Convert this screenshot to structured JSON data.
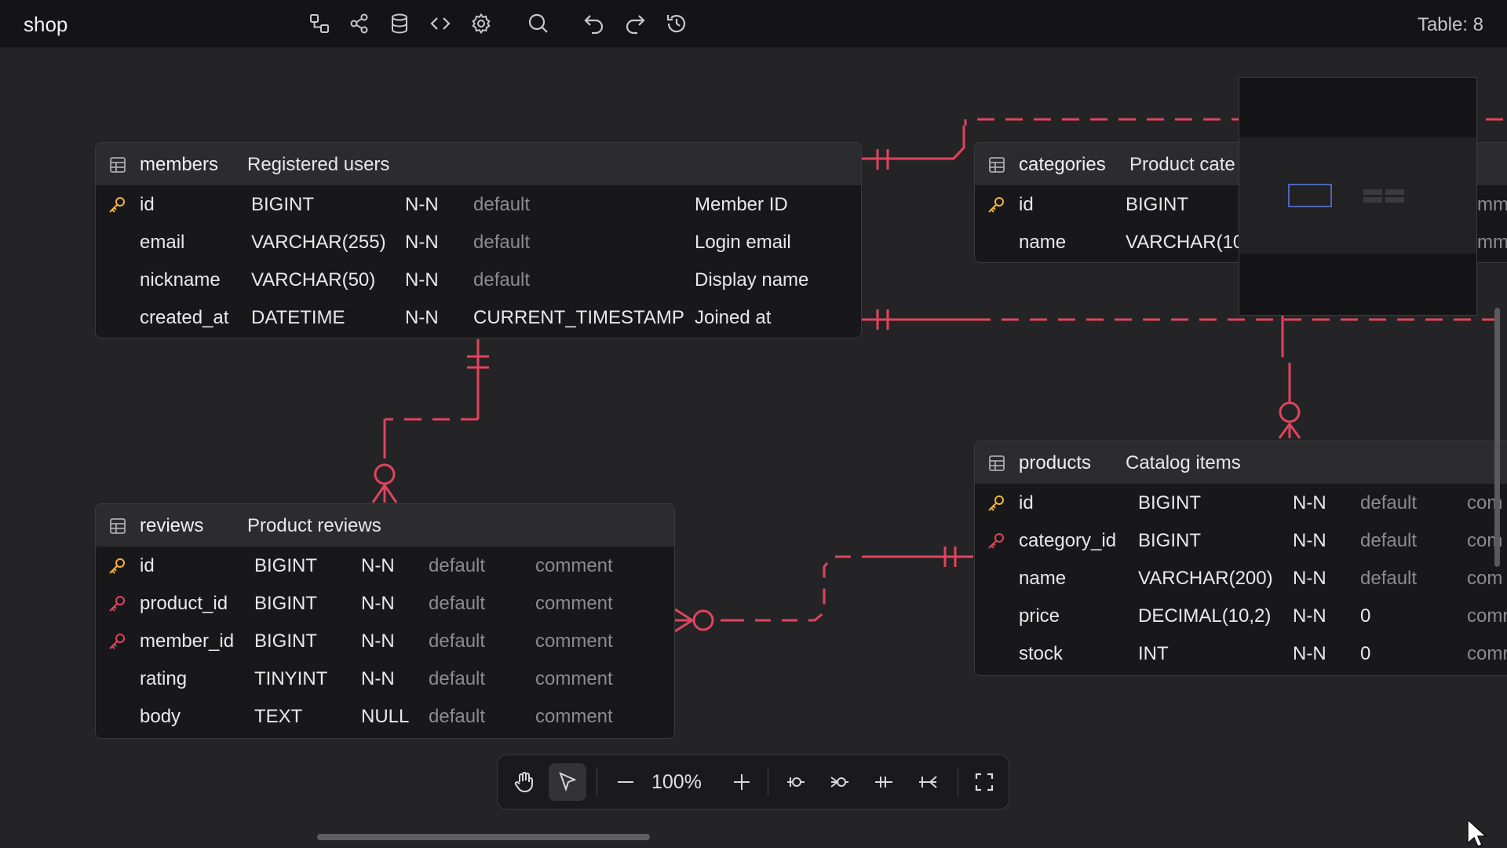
{
  "app": {
    "title": "shop",
    "table_count": "Table: 8"
  },
  "toolbar": {
    "icons": [
      "layout-icon",
      "share-icon",
      "database-icon",
      "code-icon",
      "settings-icon",
      "search-icon",
      "undo-icon",
      "redo-icon",
      "history-icon"
    ]
  },
  "tables": {
    "members": {
      "name": "members",
      "comment": "Registered users",
      "rows": [
        {
          "key": "primary",
          "name": "id",
          "type": "BIGINT",
          "null": "N-N",
          "default": "default",
          "comment": "Member ID"
        },
        {
          "key": "",
          "name": "email",
          "type": "VARCHAR(255)",
          "null": "N-N",
          "default": "default",
          "comment": "Login email"
        },
        {
          "key": "",
          "name": "nickname",
          "type": "VARCHAR(50)",
          "null": "N-N",
          "default": "default",
          "comment": "Display name"
        },
        {
          "key": "",
          "name": "created_at",
          "type": "DATETIME",
          "null": "N-N",
          "default": "CURRENT_TIMESTAMP",
          "comment": "Joined at"
        }
      ]
    },
    "categories": {
      "name": "categories",
      "comment": "Product cate",
      "rows": [
        {
          "key": "primary",
          "name": "id",
          "type": "BIGINT",
          "comment": "mm"
        },
        {
          "key": "",
          "name": "name",
          "type": "VARCHAR(10",
          "comment": "mm"
        }
      ]
    },
    "reviews": {
      "name": "reviews",
      "comment": "Product reviews",
      "rows": [
        {
          "key": "primary",
          "name": "id",
          "type": "BIGINT",
          "null": "N-N",
          "default": "default",
          "comment": "comment"
        },
        {
          "key": "foreign",
          "name": "product_id",
          "type": "BIGINT",
          "null": "N-N",
          "default": "default",
          "comment": "comment"
        },
        {
          "key": "foreign",
          "name": "member_id",
          "type": "BIGINT",
          "null": "N-N",
          "default": "default",
          "comment": "comment"
        },
        {
          "key": "",
          "name": "rating",
          "type": "TINYINT",
          "null": "N-N",
          "default": "default",
          "comment": "comment"
        },
        {
          "key": "",
          "name": "body",
          "type": "TEXT",
          "null": "NULL",
          "default": "default",
          "comment": "comment"
        }
      ]
    },
    "products": {
      "name": "products",
      "comment": "Catalog items",
      "rows": [
        {
          "key": "primary",
          "name": "id",
          "type": "BIGINT",
          "null": "N-N",
          "default": "default",
          "comment": "com"
        },
        {
          "key": "foreign",
          "name": "category_id",
          "type": "BIGINT",
          "null": "N-N",
          "default": "default",
          "comment": "com"
        },
        {
          "key": "",
          "name": "name",
          "type": "VARCHAR(200)",
          "null": "N-N",
          "default": "default",
          "comment": "com"
        },
        {
          "key": "",
          "name": "price",
          "type": "DECIMAL(10,2)",
          "null": "N-N",
          "default": "0",
          "comment": "comr"
        },
        {
          "key": "",
          "name": "stock",
          "type": "INT",
          "null": "N-N",
          "default": "0",
          "comment": "comr"
        }
      ]
    }
  },
  "zoom": {
    "label": "100%"
  },
  "colors": {
    "relation": "#e0445e",
    "primary_key": "#f2b33a",
    "foreign_key": "#e0445e",
    "minimap_view": "#4f64b5"
  }
}
